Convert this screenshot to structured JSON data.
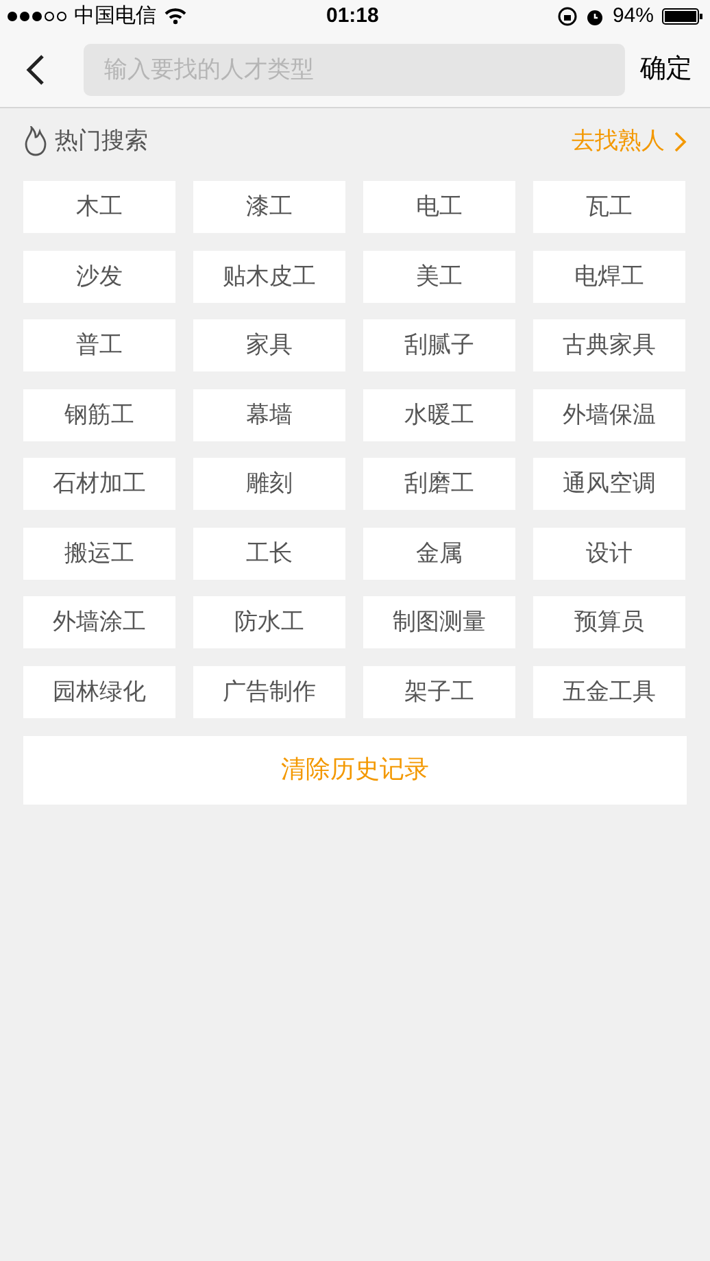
{
  "status_bar": {
    "carrier": "中国电信",
    "time": "01:18",
    "battery": "94%"
  },
  "header": {
    "search": {
      "placeholder": "输入要找的人才类型"
    },
    "confirm": "确定"
  },
  "section": {
    "title": "热门搜索",
    "link": "去找熟人"
  },
  "tags": [
    "木工",
    "漆工",
    "电工",
    "瓦工",
    "沙发",
    "贴木皮工",
    "美工",
    "电焊工",
    "普工",
    "家具",
    "刮腻子",
    "古典家具",
    "钢筋工",
    "幕墙",
    "水暖工",
    "外墙保温",
    "石材加工",
    "雕刻",
    "刮磨工",
    "通风空调",
    "搬运工",
    "工长",
    "金属",
    "设计",
    "外墙涂工",
    "防水工",
    "制图测量",
    "预算员",
    "园林绿化",
    "广告制作",
    "架子工",
    "五金工具"
  ],
  "clear_button": "清除历史记录"
}
